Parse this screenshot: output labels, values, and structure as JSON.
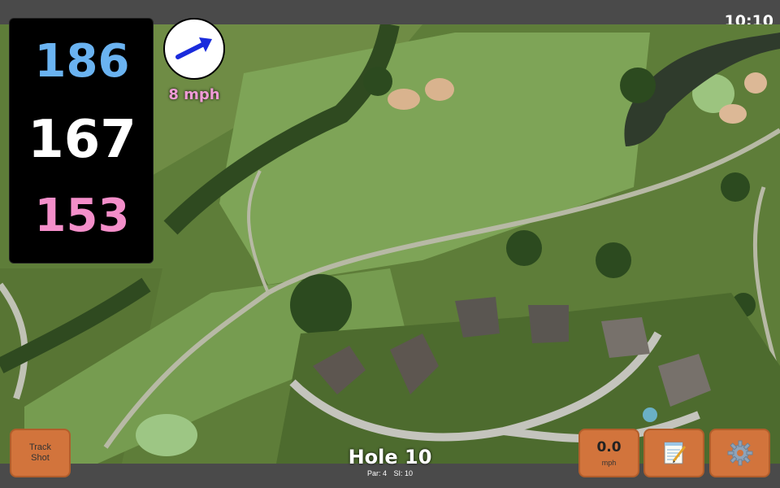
{
  "status_bar": {
    "time": "10:10"
  },
  "distances": {
    "back": "186",
    "center": "167",
    "front": "153"
  },
  "wind": {
    "speed_label": "8 mph",
    "direction_icon": "wind-arrow-icon"
  },
  "buttons": {
    "track_shot_line1": "Track",
    "track_shot_line2": "Shot",
    "speed_value": "0.0",
    "speed_unit": "mph",
    "notes_icon": "notepad-icon",
    "settings_icon": "gear-icon"
  },
  "hole": {
    "title": "Hole 10",
    "par": "Par: 4",
    "si": "SI: 10"
  },
  "colors": {
    "back": "#6ab3f1",
    "center": "#ffffff",
    "front": "#f38ec9",
    "button": "#d2743c"
  }
}
